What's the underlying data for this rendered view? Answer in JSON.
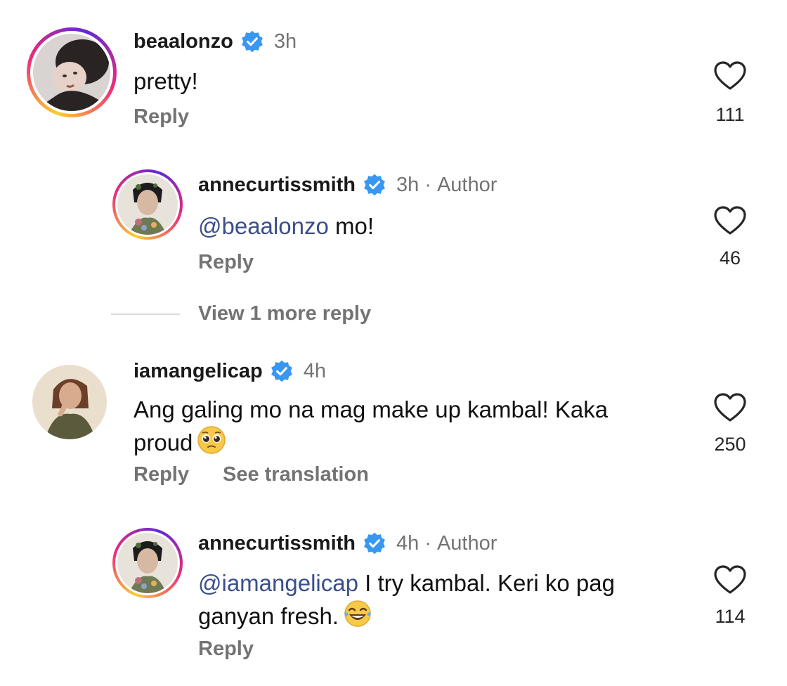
{
  "comments": [
    {
      "username": "beaalonzo",
      "time": "3h",
      "text": "pretty!",
      "reply_label": "Reply",
      "likes": "111"
    },
    {
      "username": "annecurtissmith",
      "time": "3h",
      "author_badge": "Author",
      "separator": "·",
      "mention": "@beaalonzo",
      "text": " mo!",
      "reply_label": "Reply",
      "likes": "46"
    },
    {
      "username": "iamangelicap",
      "time": "4h",
      "text_line1": "Ang galing mo na mag make up kambal! Kaka",
      "text_line2": "proud",
      "reply_label": "Reply",
      "translate_label": "See translation",
      "likes": "250"
    },
    {
      "username": "annecurtissmith",
      "time": "4h",
      "author_badge": "Author",
      "separator": "·",
      "mention": "@iamangelicap",
      "text_line1": " I try kambal. Keri ko pag",
      "text_line2": "ganyan fresh.",
      "reply_label": "Reply",
      "likes": "114"
    }
  ],
  "view_more_replies": "View 1 more reply",
  "icons": {
    "verified": "verified-badge-icon",
    "heart": "heart-outline-icon",
    "emoji_pleading": "pleading-face-emoji",
    "emoji_laughing": "tears-of-joy-emoji"
  },
  "colors": {
    "verified_blue": "#3897f0",
    "muted_text": "#737373",
    "mention": "#3b4f8a"
  }
}
